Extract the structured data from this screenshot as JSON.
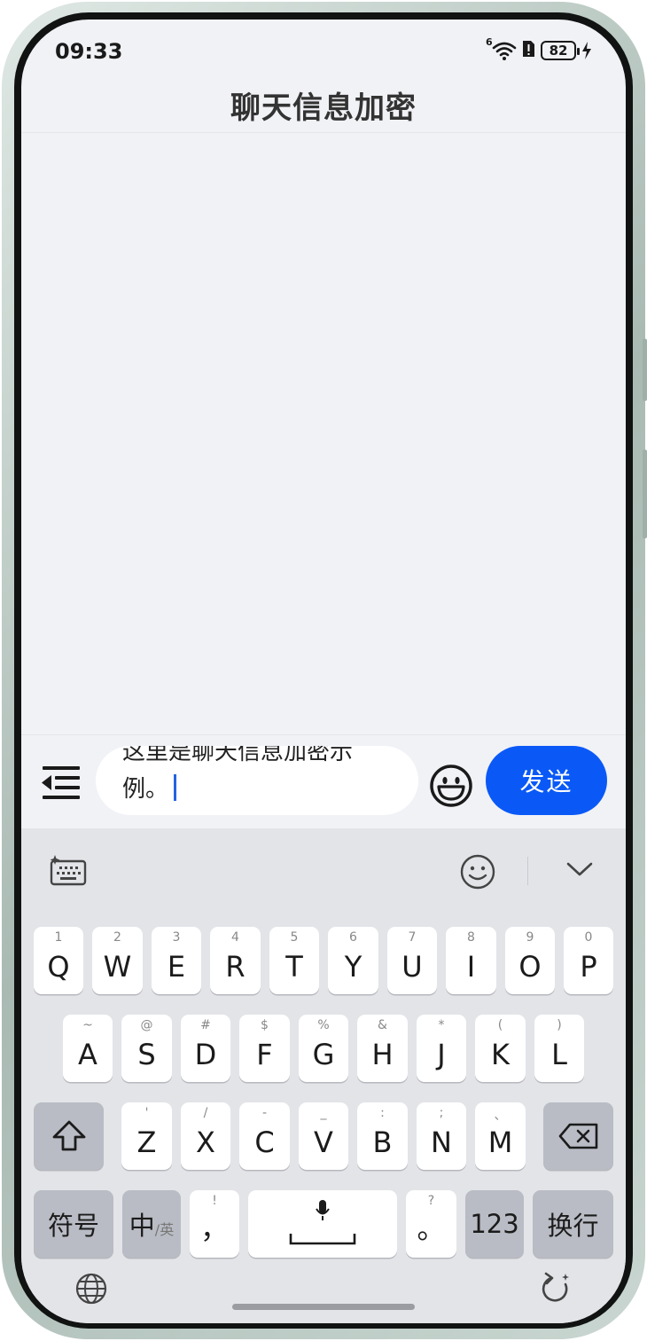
{
  "status_bar": {
    "time": "09:33",
    "signal_label": "6",
    "battery": "82"
  },
  "header": {
    "title": "聊天信息加密"
  },
  "input_bar": {
    "text_line1": "这里是聊天信息加密示",
    "text_line2": "例。",
    "send_label": "发送"
  },
  "keyboard": {
    "row1": [
      {
        "main": "Q",
        "sub": "1"
      },
      {
        "main": "W",
        "sub": "2"
      },
      {
        "main": "E",
        "sub": "3"
      },
      {
        "main": "R",
        "sub": "4"
      },
      {
        "main": "T",
        "sub": "5"
      },
      {
        "main": "Y",
        "sub": "6"
      },
      {
        "main": "U",
        "sub": "7"
      },
      {
        "main": "I",
        "sub": "8"
      },
      {
        "main": "O",
        "sub": "9"
      },
      {
        "main": "P",
        "sub": "0"
      }
    ],
    "row2": [
      {
        "main": "A",
        "sub": "~"
      },
      {
        "main": "S",
        "sub": "@"
      },
      {
        "main": "D",
        "sub": "#"
      },
      {
        "main": "F",
        "sub": "$"
      },
      {
        "main": "G",
        "sub": "%"
      },
      {
        "main": "H",
        "sub": "&"
      },
      {
        "main": "J",
        "sub": "*"
      },
      {
        "main": "K",
        "sub": "("
      },
      {
        "main": "L",
        "sub": ")"
      }
    ],
    "row3": [
      {
        "main": "Z",
        "sub": "'"
      },
      {
        "main": "X",
        "sub": "/"
      },
      {
        "main": "C",
        "sub": "-"
      },
      {
        "main": "V",
        "sub": "_"
      },
      {
        "main": "B",
        "sub": ":"
      },
      {
        "main": "N",
        "sub": ";"
      },
      {
        "main": "M",
        "sub": "、"
      }
    ],
    "symbols_label": "符号",
    "lang_main": "中",
    "lang_sub": "/英",
    "comma": "，",
    "comma_sub": "!",
    "period": "。",
    "period_sub": "?",
    "numbers_label": "123",
    "enter_label": "换行"
  },
  "colors": {
    "accent": "#0a59f7",
    "caret": "#2463e0",
    "screen_bg": "#f1f2f6",
    "keyboard_bg": "#e3e4e8"
  }
}
